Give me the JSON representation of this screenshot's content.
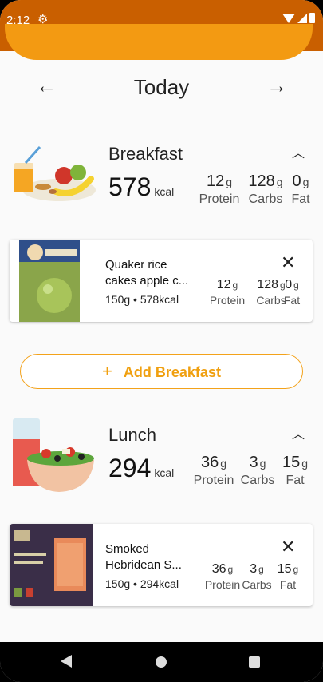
{
  "status_bar": {
    "time": "2:12",
    "settings_icon": "gear-icon",
    "wifi_icon": "wifi-icon",
    "signal_icon": "signal-icon",
    "battery_icon": "battery-icon"
  },
  "date_nav": {
    "title": "Today",
    "prev_icon": "arrow-left-icon",
    "next_icon": "arrow-right-icon"
  },
  "breakfast": {
    "name": "Breakfast",
    "kcal": "578",
    "kcal_unit": "kcal",
    "macros": [
      {
        "value": "12",
        "unit": "g",
        "label": "Protein"
      },
      {
        "value": "128",
        "unit": "g",
        "label": "Carbs"
      },
      {
        "value": "0",
        "unit": "g",
        "label": "Fat"
      }
    ],
    "foods": [
      {
        "name": "Quaker rice cakes apple c...",
        "sub": "150g • 578kcal",
        "macros": [
          {
            "value": "12",
            "unit": "g",
            "label": "Protein"
          },
          {
            "value": "128",
            "unit": "g",
            "label": "Carbs"
          },
          {
            "value": "0",
            "unit": "g",
            "label": "Fat"
          }
        ]
      }
    ],
    "add_label": "Add Breakfast"
  },
  "lunch": {
    "name": "Lunch",
    "kcal": "294",
    "kcal_unit": "kcal",
    "macros": [
      {
        "value": "36",
        "unit": "g",
        "label": "Protein"
      },
      {
        "value": "3",
        "unit": "g",
        "label": "Carbs"
      },
      {
        "value": "15",
        "unit": "g",
        "label": "Fat"
      }
    ],
    "foods": [
      {
        "name": "Smoked Hebridean S...",
        "sub": "150g • 294kcal",
        "macros": [
          {
            "value": "36",
            "unit": "g",
            "label": "Protein"
          },
          {
            "value": "3",
            "unit": "g",
            "label": "Carbs"
          },
          {
            "value": "15",
            "unit": "g",
            "label": "Fat"
          }
        ]
      }
    ]
  },
  "colors": {
    "accent": "#f39a12",
    "status_bar": "#c95f00",
    "background": "#fafafa"
  }
}
